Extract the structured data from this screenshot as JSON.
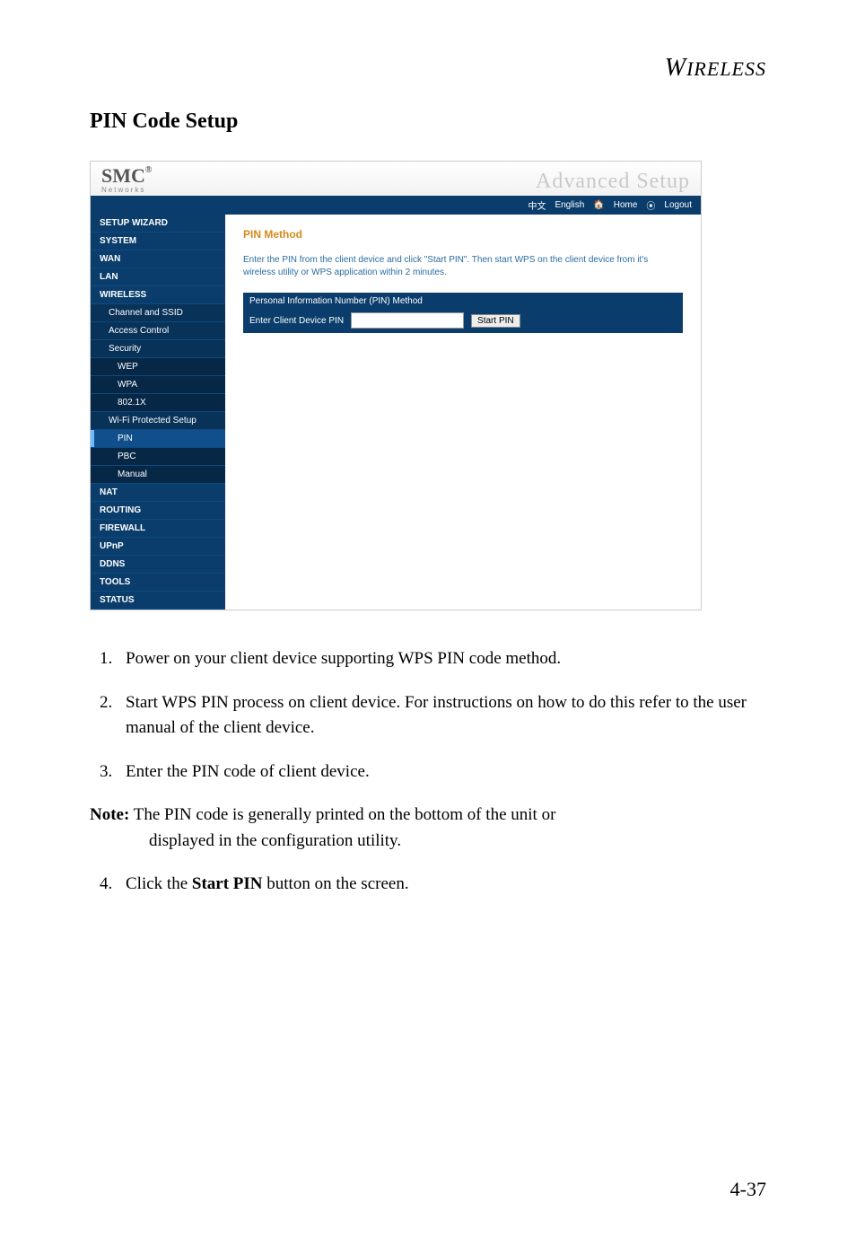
{
  "running_head": "WIRELESS",
  "section_title": "PIN Code Setup",
  "screenshot": {
    "logo_main": "SMC",
    "logo_reg": "®",
    "logo_sub": "Networks",
    "logo_right": "Advanced Setup",
    "topbar": {
      "lang_cn": "中文",
      "lang_en": "English",
      "home": "Home",
      "logout": "Logout"
    },
    "sidebar": [
      {
        "label": "SETUP WIZARD",
        "level": 1
      },
      {
        "label": "SYSTEM",
        "level": 1
      },
      {
        "label": "WAN",
        "level": 1
      },
      {
        "label": "LAN",
        "level": 1
      },
      {
        "label": "WIRELESS",
        "level": 1
      },
      {
        "label": "Channel and SSID",
        "level": 2
      },
      {
        "label": "Access Control",
        "level": 2
      },
      {
        "label": "Security",
        "level": 2
      },
      {
        "label": "WEP",
        "level": 3
      },
      {
        "label": "WPA",
        "level": 3
      },
      {
        "label": "802.1X",
        "level": 3
      },
      {
        "label": "Wi-Fi Protected Setup",
        "level": 2
      },
      {
        "label": "PIN",
        "level": 3,
        "active": true
      },
      {
        "label": "PBC",
        "level": 3
      },
      {
        "label": "Manual",
        "level": 3
      },
      {
        "label": "NAT",
        "level": 1
      },
      {
        "label": "ROUTING",
        "level": 1
      },
      {
        "label": "FIREWALL",
        "level": 1
      },
      {
        "label": "UPnP",
        "level": 1
      },
      {
        "label": "DDNS",
        "level": 1
      },
      {
        "label": "TOOLS",
        "level": 1
      },
      {
        "label": "STATUS",
        "level": 1
      }
    ],
    "content": {
      "title": "PIN Method",
      "desc": "Enter the PIN from the client device and click \"Start PIN\". Then start WPS on the client device from it's wireless utility or WPS application within 2 minutes.",
      "box_title": "Personal Information Number (PIN) Method",
      "field_label": "Enter Client Device PIN",
      "button": "Start PIN"
    }
  },
  "steps": [
    "Power on your client device supporting WPS PIN code method.",
    "Start WPS PIN process on client device. For instructions on how to do this refer to the user manual of the client device.",
    "Enter the PIN code of client device."
  ],
  "note": {
    "label": "Note:",
    "text_line1": "The PIN code is generally printed on the bottom of the unit or",
    "text_line2": "displayed in the configuration utility."
  },
  "step4_pre": "Click the ",
  "step4_bold": "Start PIN",
  "step4_post": " button on the screen.",
  "page_number": "4-37"
}
